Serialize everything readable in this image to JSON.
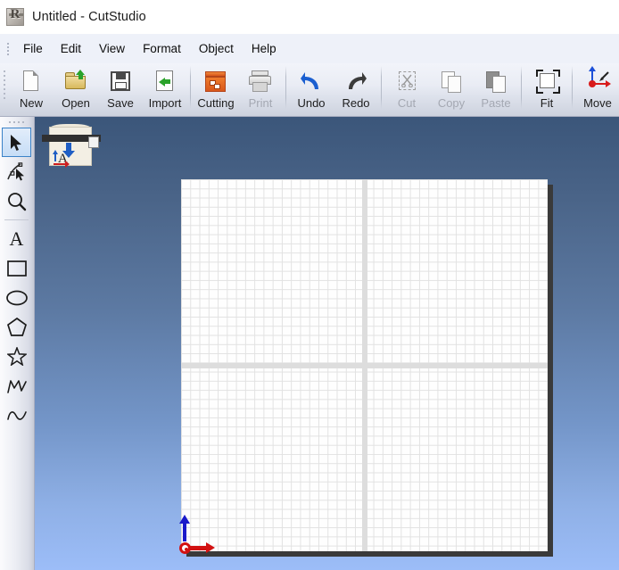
{
  "window": {
    "title": "Untitled - CutStudio",
    "app_icon": "roland-logo-icon",
    "document_name": "Untitled",
    "app_name": "CutStudio"
  },
  "menubar": {
    "items": [
      {
        "label": "File"
      },
      {
        "label": "Edit"
      },
      {
        "label": "View"
      },
      {
        "label": "Format"
      },
      {
        "label": "Object"
      },
      {
        "label": "Help"
      }
    ]
  },
  "toolbar": {
    "buttons": [
      {
        "label": "New",
        "icon": "new-page-icon",
        "enabled": true
      },
      {
        "label": "Open",
        "icon": "open-folder-icon",
        "enabled": true
      },
      {
        "label": "Save",
        "icon": "floppy-disk-icon",
        "enabled": true
      },
      {
        "label": "Import",
        "icon": "import-arrow-icon",
        "enabled": true
      },
      {
        "label": "Cutting",
        "icon": "cutting-machine-icon",
        "enabled": true
      },
      {
        "label": "Print",
        "icon": "printer-icon",
        "enabled": false
      },
      {
        "label": "Undo",
        "icon": "undo-arrow-icon",
        "enabled": true
      },
      {
        "label": "Redo",
        "icon": "redo-arrow-icon",
        "enabled": true
      },
      {
        "label": "Cut",
        "icon": "scissors-icon",
        "enabled": false
      },
      {
        "label": "Copy",
        "icon": "copy-pages-icon",
        "enabled": false
      },
      {
        "label": "Paste",
        "icon": "clipboard-paste-icon",
        "enabled": false
      },
      {
        "label": "Fit",
        "icon": "fit-to-selection-icon",
        "enabled": true
      },
      {
        "label": "Move",
        "icon": "move-origin-icon",
        "enabled": true
      }
    ]
  },
  "tool_palette": {
    "tools": [
      {
        "name": "selection-arrow-tool",
        "selected": true
      },
      {
        "name": "node-edit-tool",
        "selected": false
      },
      {
        "name": "zoom-magnifier-tool",
        "selected": false
      },
      {
        "name": "text-tool",
        "selected": false
      },
      {
        "name": "rectangle-tool",
        "selected": false
      },
      {
        "name": "ellipse-tool",
        "selected": false
      },
      {
        "name": "polygon-tool",
        "selected": false
      },
      {
        "name": "star-tool",
        "selected": false
      },
      {
        "name": "polyline-tool",
        "selected": false
      },
      {
        "name": "curve-tool",
        "selected": false
      }
    ]
  },
  "canvas": {
    "document_thumbnail": "cutting-machine-orientation-thumbnail",
    "thumbnail_letter": "A",
    "origin_marker": "origin-axes-marker",
    "grid_visible": true,
    "center_guides_visible": true,
    "background": "#5c79a2",
    "sheet_color": "#fefefe",
    "grid_color": "#e2e2e2",
    "guide_color": "#dddddd",
    "accent_blue": "#1a1aca",
    "accent_red": "#d21111",
    "cutting_orange": "#d8571b",
    "undo_blue": "#1b5fd0"
  }
}
